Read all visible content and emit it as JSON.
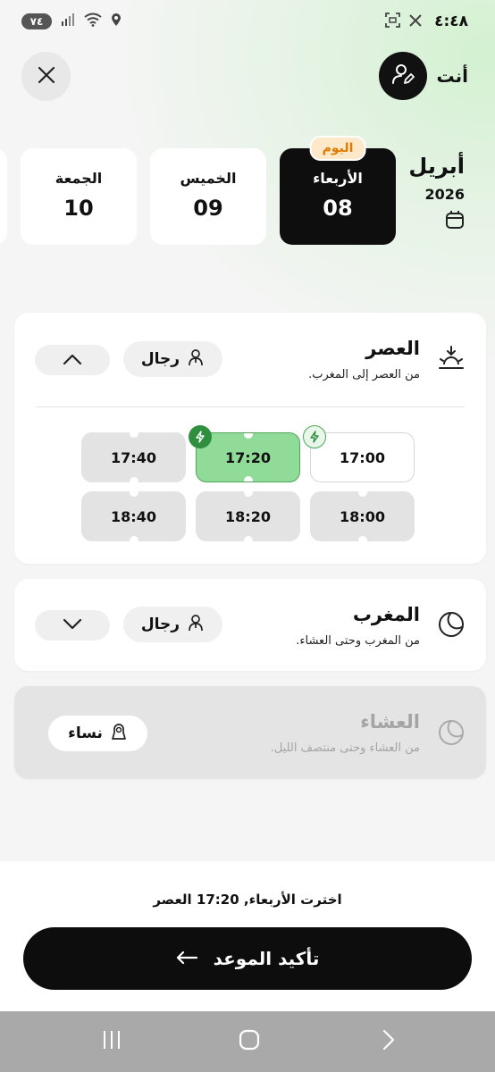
{
  "status_bar": {
    "time": "٤:٤٨",
    "battery": "٧٤",
    "icons": [
      "x-logo-icon",
      "screenshot-icon",
      "signal-icon",
      "wifi-icon",
      "location-icon"
    ]
  },
  "header": {
    "user_label": "أنت",
    "avatar_icon": "user-edit-icon",
    "close_icon": "close-icon"
  },
  "calendar": {
    "month": "أبريل",
    "year": "2026",
    "icon": "calendar-icon",
    "days": [
      {
        "name": "الأربعاء",
        "number": "08",
        "badge": "اليوم",
        "selected": true
      },
      {
        "name": "الخميس",
        "number": "09"
      },
      {
        "name": "الجمعة",
        "number": "10"
      }
    ]
  },
  "periods": [
    {
      "title": "العصر",
      "subtitle": "من العصر إلى المغرب.",
      "icon": "sunset-icon",
      "gender": "رجال",
      "gender_icon": "man-icon",
      "expanded": true,
      "slots": [
        {
          "time": "17:00",
          "state": "available",
          "bolt": "outline"
        },
        {
          "time": "17:20",
          "state": "selected",
          "bolt": "filled"
        },
        {
          "time": "17:40",
          "state": "default"
        },
        {
          "time": "18:00",
          "state": "default"
        },
        {
          "time": "18:20",
          "state": "default"
        },
        {
          "time": "18:40",
          "state": "default"
        }
      ]
    },
    {
      "title": "المغرب",
      "subtitle": "من المغرب وحتى العشاء.",
      "icon": "moon-icon",
      "gender": "رجال",
      "gender_icon": "man-icon",
      "expanded": false
    },
    {
      "title": "العشاء",
      "subtitle": "من العشاء وحتى منتصف الليل.",
      "icon": "moon-icon",
      "gender": "نساء",
      "gender_icon": "woman-icon",
      "disabled": true
    }
  ],
  "footer": {
    "summary": "اخترت الأربعاء, 17:20 العصر",
    "confirm_label": "تأكيد الموعد",
    "confirm_icon": "arrow-left-icon"
  },
  "nav": {
    "icons": [
      "recent-apps-icon",
      "home-icon",
      "back-icon"
    ]
  },
  "colors": {
    "selected_slot": "#8fdb97",
    "bolt_green": "#2f8f3f",
    "today_badge": "#e07b00",
    "dark": "#0e0e0e"
  }
}
